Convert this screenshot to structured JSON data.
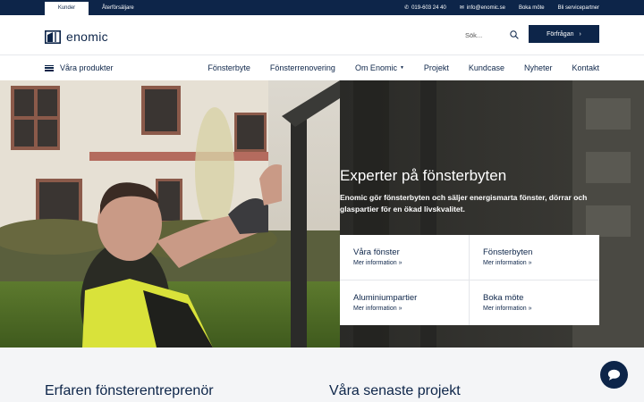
{
  "topbar": {
    "tabs": [
      {
        "label": "Kunder"
      },
      {
        "label": "Återförsäljare"
      }
    ],
    "phone": "019-603 24 40",
    "email": "info@enomic.se",
    "book": "Boka möte",
    "partner": "Bli servicepartner"
  },
  "header": {
    "logo_text": "enomic",
    "search_placeholder": "Sök...",
    "request_label": "Förfrågan",
    "request_arrow": "›"
  },
  "nav": {
    "menu_label": "Våra produkter",
    "links": [
      {
        "label": "Fönsterbyte"
      },
      {
        "label": "Fönsterrenovering"
      },
      {
        "label": "Om Enomic"
      },
      {
        "label": "Projekt"
      },
      {
        "label": "Kundcase"
      },
      {
        "label": "Nyheter"
      },
      {
        "label": "Kontakt"
      }
    ]
  },
  "hero": {
    "title": "Experter på fönsterbyten",
    "subtitle": "Enomic gör fönsterbyten och säljer energismarta fönster, dörrar och glaspartier för en ökad livskvalitet.",
    "cards": [
      {
        "title": "Våra fönster",
        "more": "Mer information »"
      },
      {
        "title": "Fönsterbyten",
        "more": "Mer information »"
      },
      {
        "title": "Aluminiumpartier",
        "more": "Mer information »"
      },
      {
        "title": "Boka möte",
        "more": "Mer information »"
      }
    ]
  },
  "sections": {
    "left_heading": "Erfaren fönsterentreprenör",
    "right_heading": "Våra senaste projekt"
  },
  "colors": {
    "navy": "#0d2549",
    "accent_yellow": "#e8ea3a"
  }
}
